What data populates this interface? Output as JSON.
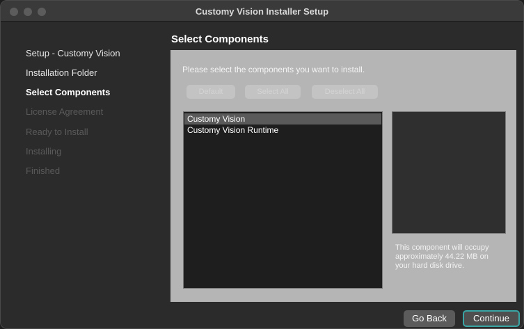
{
  "window": {
    "title": "Customy Vision Installer Setup"
  },
  "sidebar": {
    "items": [
      {
        "label": "Setup - Customy Vision",
        "state": "done"
      },
      {
        "label": "Installation Folder",
        "state": "done"
      },
      {
        "label": "Select Components",
        "state": "active"
      },
      {
        "label": "License Agreement",
        "state": "pending"
      },
      {
        "label": "Ready to Install",
        "state": "pending"
      },
      {
        "label": "Installing",
        "state": "pending"
      },
      {
        "label": "Finished",
        "state": "pending"
      }
    ]
  },
  "main": {
    "title": "Select Components",
    "instructions": "Please select the components you want to install.",
    "buttons": {
      "default": "Default",
      "select_all": "Select All",
      "deselect_all": "Deselect All"
    },
    "components": [
      {
        "label": "Customy Vision",
        "selected": true
      },
      {
        "label": "Customy Vision Runtime",
        "selected": false
      }
    ],
    "description": "This component will occupy approximately 44.22 MB on your hard disk drive."
  },
  "footer": {
    "go_back": "Go Back",
    "continue": "Continue"
  },
  "colors": {
    "accent_focus": "#3aa5a5",
    "panel_bg": "#b5b5b5",
    "list_bg": "#1e1e1e",
    "selection": "#5a5a5a"
  }
}
